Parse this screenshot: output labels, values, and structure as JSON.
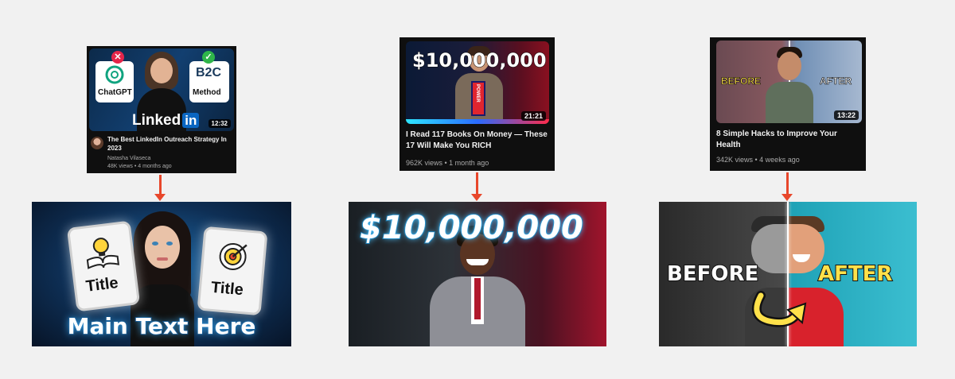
{
  "card1": {
    "badge_left": "ChatGPT",
    "badge_right": "Method",
    "logo_text": "Linked",
    "logo_in": "in",
    "duration": "12:32",
    "title": "The Best LinkedIn Outreach Strategy In 2023",
    "channel": "Natasha Vilaseca",
    "meta": "48K views • 4 months ago"
  },
  "card2": {
    "overlay_text": "$10,000,000",
    "book_text": "POWER",
    "duration": "21:21",
    "title": "I Read 117 Books On Money — These 17 Will Make You RICH",
    "meta": "962K views • 1 month ago"
  },
  "card3": {
    "before_label": "BEFORE",
    "after_label": "AFTER",
    "duration": "13:22",
    "title": "8 Simple Hacks to Improve Your Health",
    "meta": "342K views • 4 weeks ago"
  },
  "big1": {
    "left_card_label": "Title",
    "right_card_label": "Title",
    "main_text": "Main Text Here"
  },
  "big2": {
    "headline": "$10,000,000"
  },
  "big3": {
    "before_label": "BEFORE",
    "after_label": "AFTER"
  },
  "colors": {
    "page_bg": "#f1f1f1",
    "arrow": "#e8472b",
    "card_bg": "#0f0f0f",
    "linkedin_blue": "#0a66c2",
    "before_yellow": "#ffe14a"
  }
}
